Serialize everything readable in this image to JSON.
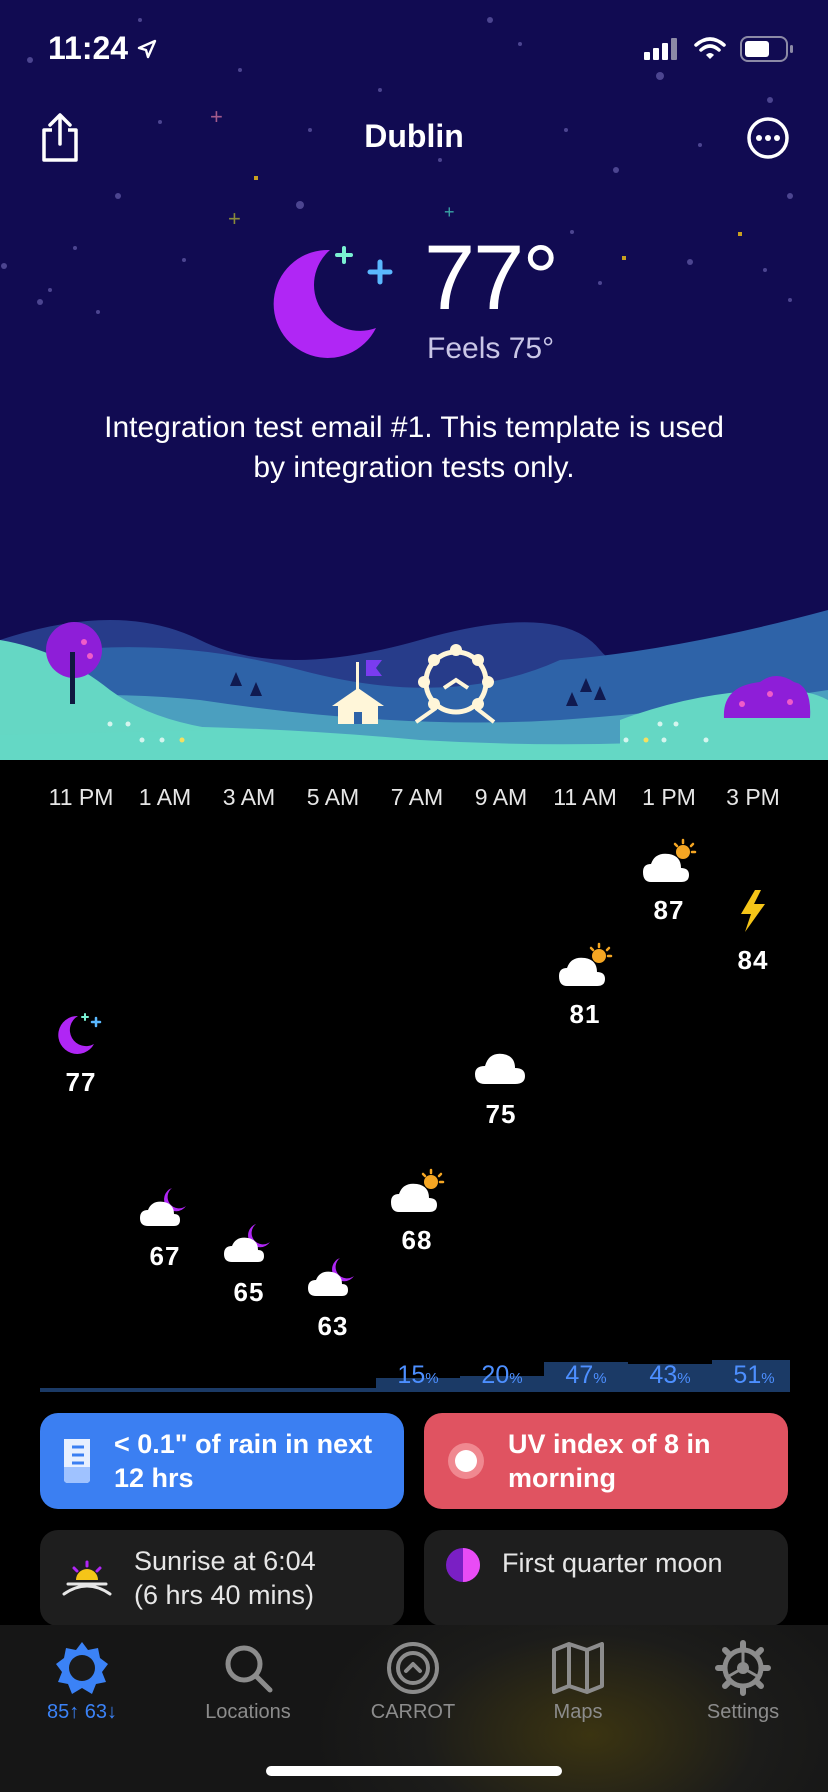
{
  "status_bar": {
    "time": "11:24"
  },
  "header": {
    "city": "Dublin"
  },
  "current": {
    "temperature": "77°",
    "feels_like": "Feels 75°",
    "summary": "Integration test email #1. This template is used by integration tests only."
  },
  "hourly": {
    "labels": [
      "11 PM",
      "1 AM",
      "3 AM",
      "5 AM",
      "7 AM",
      "9 AM",
      "11 AM",
      "1 PM",
      "3 PM"
    ],
    "temps": [
      "77",
      "67",
      "65",
      "63",
      "68",
      "75",
      "81",
      "87",
      "84"
    ],
    "icons": [
      "moon-stars-icon",
      "cloud-moon-icon",
      "cloud-moon-icon",
      "cloud-moon-icon",
      "cloud-sun-icon",
      "cloud-icon",
      "cloud-sun-icon",
      "cloud-sun-icon",
      "lightning-icon"
    ],
    "precip": [
      {
        "value": "15",
        "unit": "%"
      },
      {
        "value": "20",
        "unit": "%"
      },
      {
        "value": "47",
        "unit": "%"
      },
      {
        "value": "43",
        "unit": "%"
      },
      {
        "value": "51",
        "unit": "%"
      }
    ]
  },
  "cards": {
    "rain": "< 0.1\" of rain in next 12 hrs",
    "uv": "UV index of 8 in morning",
    "sunrise_line1": "Sunrise at 6:04",
    "sunrise_line2": "(6 hrs 40 mins)",
    "moon": "First quarter moon"
  },
  "tabs": [
    {
      "label": "85↑ 63↓",
      "icon": "sun-icon"
    },
    {
      "label": "Locations",
      "icon": "search-icon"
    },
    {
      "label": "CARROT",
      "icon": "carrot-icon"
    },
    {
      "label": "Maps",
      "icon": "map-icon"
    },
    {
      "label": "Settings",
      "icon": "gear-icon"
    }
  ],
  "colors": {
    "sky": "#110b52",
    "accent_blue": "#3b82f6",
    "rain_card": "#3b7ff2",
    "uv_card": "#e05361",
    "moon_purple": "#b026f5"
  }
}
